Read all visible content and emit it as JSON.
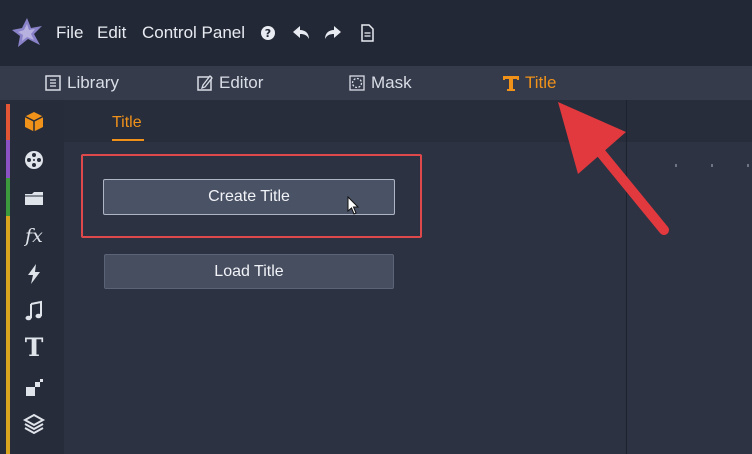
{
  "menubar": {
    "items": [
      "File",
      "Edit",
      "Control Panel"
    ],
    "icons": [
      "help-icon",
      "undo-icon",
      "redo-icon",
      "document-icon"
    ]
  },
  "mode_tabs": [
    {
      "label": "Library",
      "icon": "library-icon",
      "active": false
    },
    {
      "label": "Editor",
      "icon": "editor-icon",
      "active": false
    },
    {
      "label": "Mask",
      "icon": "mask-icon",
      "active": false
    },
    {
      "label": "Title",
      "icon": "title-icon",
      "active": true
    }
  ],
  "sidebar": {
    "icons": [
      "package-icon",
      "film-reel-icon",
      "folder-icon",
      "fx-icon",
      "lightning-icon",
      "music-icon",
      "text-icon",
      "transition-icon",
      "layers-icon"
    ],
    "fx_label": "fx",
    "text_label": "T"
  },
  "content": {
    "subtab": "Title",
    "create_button": "Create Title",
    "load_button": "Load Title"
  },
  "colors": {
    "accent": "#f0921a",
    "highlight": "#e0494b"
  }
}
